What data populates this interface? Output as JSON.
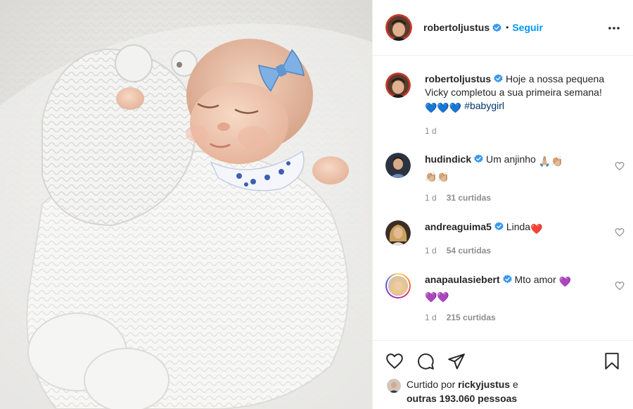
{
  "post": {
    "author": "robertoljustus",
    "follow_label": "Seguir",
    "dot": "•",
    "caption": {
      "username": "robertoljustus",
      "text": "Hoje a nossa pequena Vicky completou a sua primeira semana!",
      "emojis": "💙💙💙",
      "hashtag": "#babygirl",
      "time": "1 d"
    }
  },
  "comments": [
    {
      "username": "hudindick",
      "text": "Um anjinho",
      "emoji_line1": "🙏🏼👏🏼",
      "emoji_line2": "👏🏼👏🏼",
      "time": "1 d",
      "likes": "31 curtidas"
    },
    {
      "username": "andreaguima5",
      "text": "Linda",
      "emoji": "❤️",
      "time": "1 d",
      "likes": "54 curtidas"
    },
    {
      "username": "anapaulasiebert",
      "text": "Mto amor",
      "emoji_line1": "💜",
      "emoji_line2": "💜💜",
      "time": "1 d",
      "likes": "215 curtidas"
    }
  ],
  "likes_summary": {
    "prefix": "Curtido por",
    "user": "rickyjustus",
    "mid": "e",
    "others": "outras 193.060 pessoas"
  },
  "icons": [
    "verified-badge-icon",
    "more-options-icon",
    "heart-icon",
    "comment-icon",
    "share-icon",
    "bookmark-icon"
  ],
  "colors": {
    "link": "#0095f6",
    "verified": "#3897f0",
    "muted": "#8e8e8e",
    "hashtag": "#00376b"
  }
}
